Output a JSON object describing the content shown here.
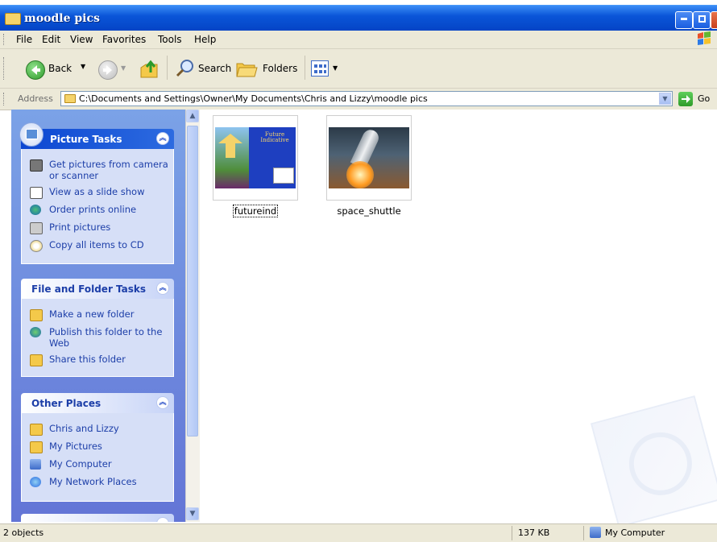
{
  "window": {
    "title": "moodle pics"
  },
  "menu": [
    "File",
    "Edit",
    "View",
    "Favorites",
    "Tools",
    "Help"
  ],
  "toolbar": {
    "back_label": "Back",
    "search_label": "Search",
    "folders_label": "Folders"
  },
  "address": {
    "label": "Address",
    "path": "C:\\Documents and Settings\\Owner\\My Documents\\Chris and Lizzy\\moodle pics",
    "go_label": "Go"
  },
  "panels": {
    "picture_tasks": {
      "title": "Picture Tasks",
      "items": [
        "Get pictures from camera or scanner",
        "View as a slide show",
        "Order prints online",
        "Print pictures",
        "Copy all items to CD"
      ]
    },
    "file_folder_tasks": {
      "title": "File and Folder Tasks",
      "items": [
        "Make a new folder",
        "Publish this folder to the Web",
        "Share this folder"
      ]
    },
    "other_places": {
      "title": "Other Places",
      "items": [
        "Chris and Lizzy",
        "My Pictures",
        "My Computer",
        "My Network Places"
      ]
    }
  },
  "files": [
    {
      "name": "futureind",
      "thumb_title": "Future Indicative"
    },
    {
      "name": "space_shuttle"
    }
  ],
  "status": {
    "objects": "2 objects",
    "size": "137 KB",
    "location": "My Computer"
  },
  "colors": {
    "titlebar": "#0a55d8",
    "task_link": "#1c3ea8",
    "panel_header_dark": "#0c47d2",
    "pane_bg": "#6375d6"
  }
}
